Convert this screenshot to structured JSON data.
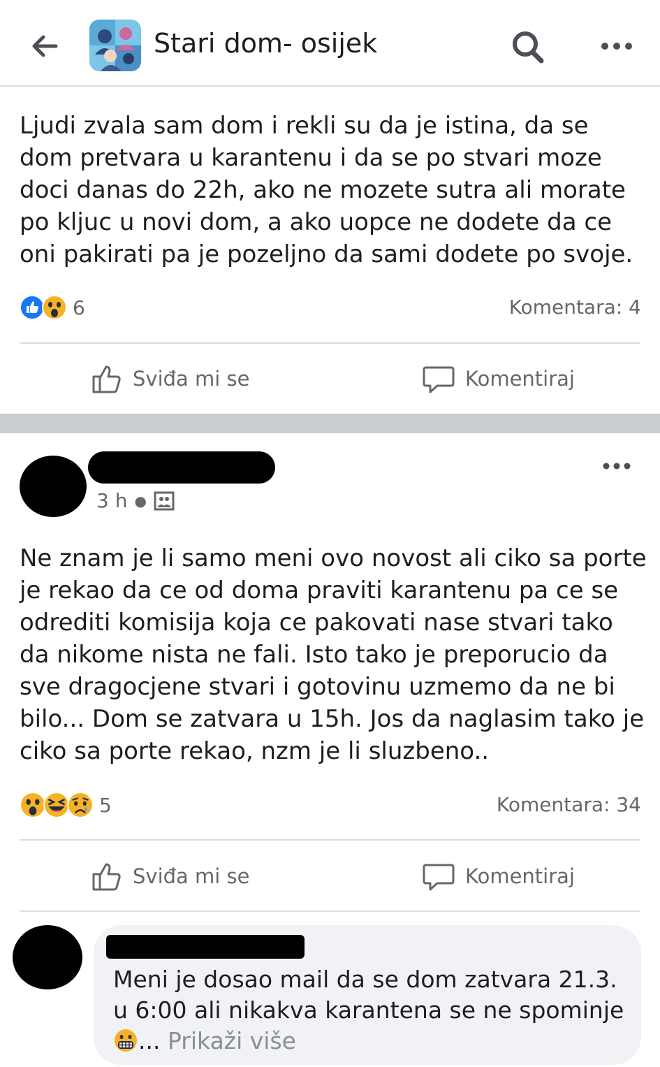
{
  "header": {
    "title": "Stari dom- osijek",
    "icons": [
      "back-arrow-icon",
      "search-icon",
      "more-options-icon"
    ]
  },
  "post1": {
    "text": "Ljudi zvala sam dom i rekli su da je istina, da se dom pretvara u karantenu i da se po stvari moze doci danas do 22h, ako ne mozete sutra ali morate po kljuc u novi dom, a ako uopce ne dodete da ce oni pakirati pa je pozeljno da sami dodete po svoje.",
    "reactions": [
      "like",
      "wow"
    ],
    "reaction_count": "6",
    "comments_label": "Komentara: 4",
    "like_label": "Sviđa mi se",
    "comment_label": "Komentiraj"
  },
  "post2": {
    "time": "3 h",
    "text": "Ne znam je li samo meni ovo novost ali ciko sa porte je rekao da ce od doma praviti karantenu pa ce se odrediti komisija koja ce pakovati nase stvari tako da nikome nista ne fali. Isto tako je preporucio da sve dragocjene stvari i gotovinu uzmemo da ne bi bilo... Dom se zatvara u 15h. Jos da naglasim tako je ciko sa porte rekao, nzm je li sluzbeno..",
    "reactions": [
      "wow",
      "haha",
      "sad"
    ],
    "reaction_count": "5",
    "comments_label": "Komentara: 34",
    "like_label": "Sviđa mi se",
    "comment_label": "Komentiraj"
  },
  "comment": {
    "text": "Meni je dosao mail da se dom zatvara 21.3. u 6:00 ali nikakva karantena se ne spominje",
    "ellipsis": "...",
    "see_more": "Prikaži više"
  },
  "colors": {
    "text": "#1c1e21",
    "secondary": "#65676b",
    "like_blue": "#1877f2",
    "separator": "#c9ccd1",
    "bubble": "#f0f2f5"
  }
}
